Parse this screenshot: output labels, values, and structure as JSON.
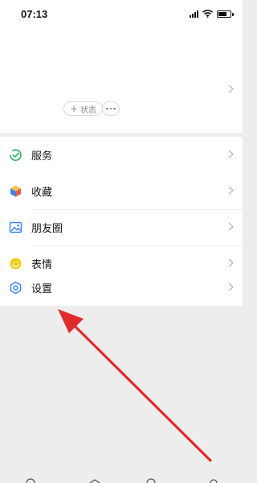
{
  "status_bar": {
    "time": "07:13",
    "battery_level": 0.8
  },
  "profile": {
    "status_button_label": "状态"
  },
  "menu": {
    "services": "服务",
    "favorites": "收藏",
    "moments": "朋友圈",
    "stickers": "表情",
    "settings": "设置"
  },
  "colors": {
    "page_background": "#ededed",
    "annotation_arrow": "#e02b2b",
    "services_icon": "#2aae67",
    "favorites_icon": "#f0a02c",
    "moments_icon": "#3b82f6",
    "stickers_icon": "#f2c200",
    "settings_icon": "#3b82f6"
  },
  "icons": {
    "services": "services-icon",
    "favorites": "favorites-cube-icon",
    "moments": "moments-photo-icon",
    "stickers": "smiley-icon",
    "settings": "gear-icon"
  }
}
